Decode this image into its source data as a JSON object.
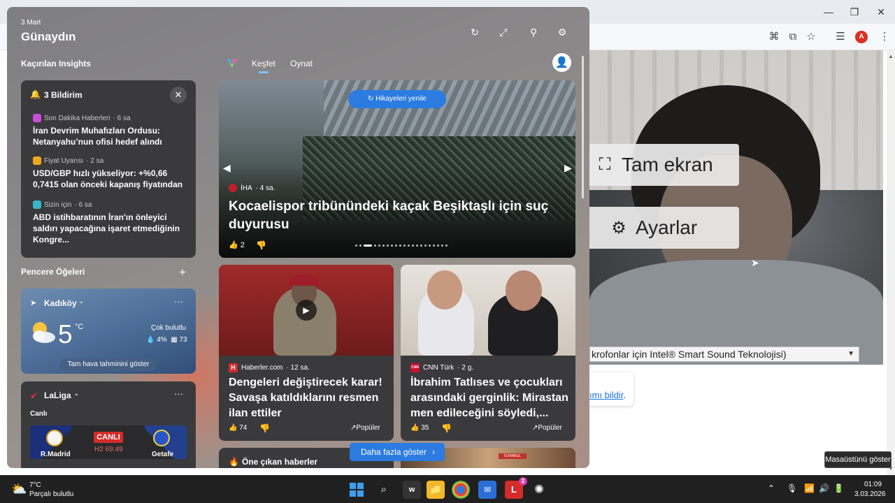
{
  "browser": {
    "toolbar_icons": [
      "translate-icon",
      "install-icon",
      "star-icon",
      "reading-list-icon"
    ],
    "profile_initial": "A"
  },
  "webcam_overlay": {
    "fullscreen_label": "Tam ekran",
    "settings_label": "Ayarlar"
  },
  "mic_select": {
    "value": "krofonlar için Intel® Smart Sound Teknolojisi)"
  },
  "bg_card": {
    "link_text": "ımı bildir",
    "suffix": "."
  },
  "tooltip": {
    "text": "Masaüstünü göster"
  },
  "widgets": {
    "date": "3 Mart",
    "greeting": "Günaydın",
    "missed_insights_title": "Kaçırılan Insights",
    "notifications": {
      "title": "3 Bildirim",
      "items": [
        {
          "source": "Son Dakika Haberleri",
          "time": " · 6 sa",
          "headline": "İran Devrim Muhafızları Ordusu: Netanyahu’nun ofisi hedef alındı",
          "color": "#c94fd8"
        },
        {
          "source": "Fiyat Uyarısı",
          "time": " · 2 sa",
          "headline": "USD/GBP hızlı yükseliyor: +%0,66 0,7415 olan önceki kapanış fiyatından",
          "color": "#f0a81e"
        },
        {
          "source": "Sizin için",
          "time": " · 6 sa",
          "headline": "ABD istihbaratının İran'ın önleyici saldırı yapacağına işaret etmediğinin Kongre...",
          "color": "#38b6c9"
        }
      ]
    },
    "window_items_title": "Pencere Öğeleri",
    "weather": {
      "location": "Kadıköy",
      "temperature": "5",
      "unit": "°C",
      "condition": "Çok bulutlu",
      "precipitation": "4%",
      "aqi": "73",
      "forecast_button": "Tam hava tahminini göster"
    },
    "laliga": {
      "title": "LaLiga",
      "live_label": "Canlı",
      "home_team": "R.Madrid",
      "away_team": "Getafe",
      "live_badge": "CANLI",
      "match_time": "H2 69:49"
    },
    "tabs": {
      "discover": "Keşfet",
      "play": "Oynat"
    },
    "hero": {
      "refresh_label": "Hikayeleri yenile",
      "source": "İHA",
      "time": " · 4 sa.",
      "title": "Kocaelispor tribünündeki kaçak Beşiktaşlı için suç duyurusu",
      "likes": "2"
    },
    "news": [
      {
        "source": "Haberler.com",
        "time": " · 12 sa.",
        "title": "Dengeleri değiştirecek karar! Savaşa katıldıklarını resmen ilan ettiler",
        "likes": "74",
        "popular": "Popüler",
        "logo_letter": "H",
        "logo_color": "#d32b2b"
      },
      {
        "source": "CNN Türk",
        "time": " · 2 g.",
        "title": "İbrahim Tatlıses ve çocukları arasındaki gerginlik: Mirastan men edileceğini söyledi,...",
        "likes": "35",
        "popular": "Popüler",
        "logo_letter": "CNN",
        "logo_color": "#c8102e"
      }
    ],
    "featured_title": "Öne çıkan haberler",
    "featured_tag": "İSTANBUL",
    "show_more": "Daha fazla göster"
  },
  "taskbar": {
    "temp": "7°C",
    "condition": "Parçalı bulutlu",
    "time": "01:09",
    "date": "3.03.2026",
    "outlook_badge": "2"
  }
}
